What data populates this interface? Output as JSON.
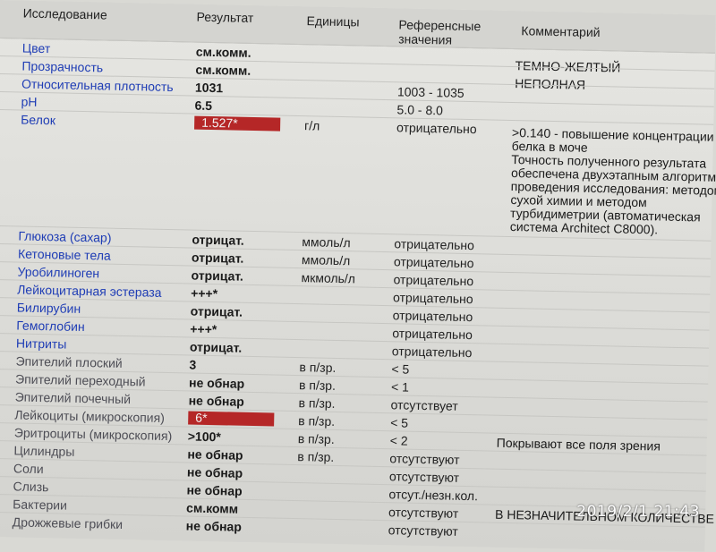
{
  "header": {
    "col_study": "Исследование",
    "col_result": "Результат",
    "col_units": "Единицы",
    "col_ref": "Референсные значения",
    "col_comment": "Комментарий"
  },
  "rows": [
    {
      "name": "Цвет",
      "result": "см.комм.",
      "units": "",
      "ref": "",
      "comment": "ТЕМНО-ЖЕЛТЫЙ"
    },
    {
      "name": "Прозрачность",
      "result": "см.комм.",
      "units": "",
      "ref": "",
      "comment": "НЕПОЛНАЯ"
    },
    {
      "name": "Относительная плотность",
      "result": "1031",
      "units": "",
      "ref": "1003 - 1035",
      "comment": ""
    },
    {
      "name": "pH",
      "result": "6.5",
      "units": "",
      "ref": "5.0 - 8.0",
      "comment": ""
    },
    {
      "name": "Белок",
      "result": "1.527*",
      "units": "г/л",
      "ref": "отрицательно",
      "comment": ">0.140 - повышение концентрации\nбелка в моче\nТочность полученного результата\nобеспечена двухэтапным алгоритмом\nпроведения исследования: методом\nсухой химии и методом\nтурбидиметрии (автоматическая\nсистема Architect C8000)."
    },
    {
      "name": "Глюкоза (сахар)",
      "result": "отрицат.",
      "units": "ммоль/л",
      "ref": "отрицательно",
      "comment": ""
    },
    {
      "name": "Кетоновые тела",
      "result": "отрицат.",
      "units": "ммоль/л",
      "ref": "отрицательно",
      "comment": ""
    },
    {
      "name": "Уробилиноген",
      "result": "отрицат.",
      "units": "мкмоль/л",
      "ref": "отрицательно",
      "comment": ""
    },
    {
      "name": "Лейкоцитарная эстераза",
      "result": "+++*",
      "units": "",
      "ref": "отрицательно",
      "comment": ""
    },
    {
      "name": "Билирубин",
      "result": "отрицат.",
      "units": "",
      "ref": "отрицательно",
      "comment": ""
    },
    {
      "name": "Гемоглобин",
      "result": "+++*",
      "units": "",
      "ref": "отрицательно",
      "comment": ""
    },
    {
      "name": "Нитриты",
      "result": "отрицат.",
      "units": "",
      "ref": "отрицательно",
      "comment": ""
    },
    {
      "name": "Эпителий плоский",
      "result": "3",
      "units": "в п/зр.",
      "ref": "< 5",
      "comment": ""
    },
    {
      "name": "Эпителий переходный",
      "result": "не обнар",
      "units": "в п/зр.",
      "ref": "< 1",
      "comment": ""
    },
    {
      "name": "Эпителий почечный",
      "result": "не обнар",
      "units": "в п/зр.",
      "ref": "отсутствует",
      "comment": ""
    },
    {
      "name": "Лейкоциты (микроскопия)",
      "result": "6*",
      "units": "в п/зр.",
      "ref": "< 5",
      "comment": ""
    },
    {
      "name": "Эритроциты (микроскопия)",
      "result": ">100*",
      "units": "в п/зр.",
      "ref": "< 2",
      "comment": "Покрывают все поля зрения"
    },
    {
      "name": "Цилиндры",
      "result": "не обнар",
      "units": "в п/зр.",
      "ref": "отсутствуют",
      "comment": ""
    },
    {
      "name": "Соли",
      "result": "не обнар",
      "units": "",
      "ref": "отсутствуют",
      "comment": ""
    },
    {
      "name": "Слизь",
      "result": "не обнар",
      "units": "",
      "ref": "отсут./незн.кол.",
      "comment": ""
    },
    {
      "name": "Бактерии",
      "result": "см.комм",
      "units": "",
      "ref": "отсутствуют",
      "comment": "В НЕЗНАЧИТЕЛЬНОМ КОЛИЧЕСТВЕ"
    },
    {
      "name": "Дрожжевые грибки",
      "result": "не обнар",
      "units": "",
      "ref": "отсутствуют",
      "comment": ""
    }
  ],
  "timestamp": "2019/2/1  21:43"
}
